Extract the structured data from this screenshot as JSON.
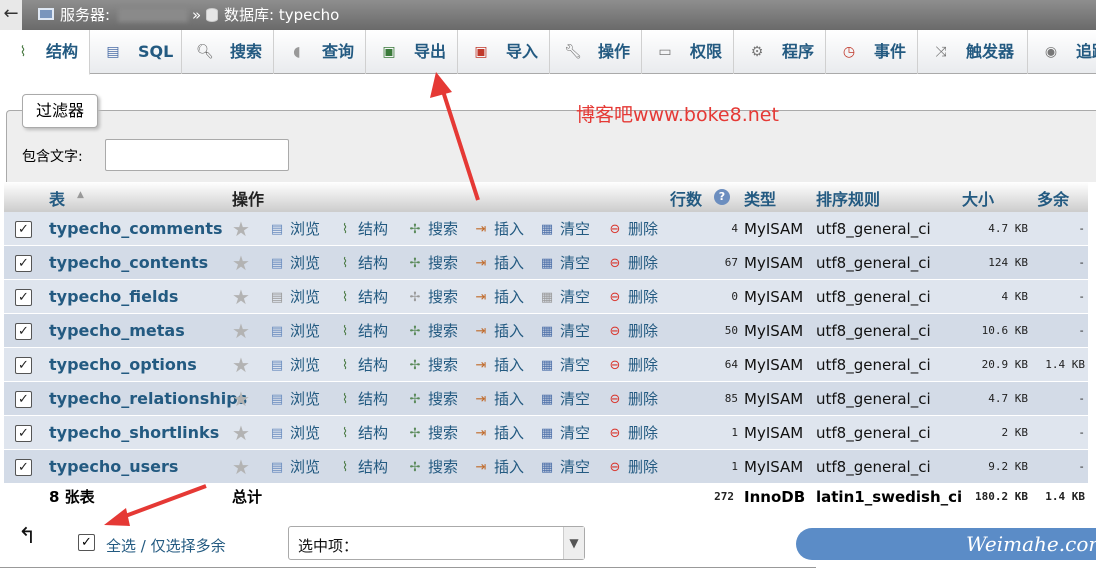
{
  "breadcrumb": {
    "back": "←",
    "server_label": "服务器:",
    "separator": "»",
    "database_label": "数据库: typecho"
  },
  "tabs": [
    {
      "label": "结构",
      "icon": "structure-icon",
      "active": true
    },
    {
      "label": "SQL",
      "icon": "sql-icon"
    },
    {
      "label": "搜索",
      "icon": "search-icon"
    },
    {
      "label": "查询",
      "icon": "query-icon"
    },
    {
      "label": "导出",
      "icon": "export-icon"
    },
    {
      "label": "导入",
      "icon": "import-icon"
    },
    {
      "label": "操作",
      "icon": "wrench-icon"
    },
    {
      "label": "权限",
      "icon": "privileges-icon"
    },
    {
      "label": "程序",
      "icon": "routines-icon"
    },
    {
      "label": "事件",
      "icon": "events-icon"
    },
    {
      "label": "触发器",
      "icon": "triggers-icon"
    },
    {
      "label": "追踪",
      "icon": "tracking-icon"
    }
  ],
  "watermark": "博客吧www.boke8.net",
  "filter": {
    "legend": "过滤器",
    "label": "包含文字:",
    "value": ""
  },
  "table": {
    "headers": {
      "table": "表",
      "action": "操作",
      "rows": "行数",
      "type": "类型",
      "collation": "排序规则",
      "size": "大小",
      "overhead": "多余"
    },
    "actions": {
      "browse": "浏览",
      "structure": "结构",
      "search": "搜索",
      "insert": "插入",
      "empty": "清空",
      "drop": "删除"
    },
    "rows": [
      {
        "name": "typecho_comments",
        "rows": "4",
        "type": "MyISAM",
        "collation": "utf8_general_ci",
        "size": "4.7 KB",
        "overhead": "-"
      },
      {
        "name": "typecho_contents",
        "rows": "67",
        "type": "MyISAM",
        "collation": "utf8_general_ci",
        "size": "124 KB",
        "overhead": "-"
      },
      {
        "name": "typecho_fields",
        "rows": "0",
        "type": "MyISAM",
        "collation": "utf8_general_ci",
        "size": "4 KB",
        "overhead": "-"
      },
      {
        "name": "typecho_metas",
        "rows": "50",
        "type": "MyISAM",
        "collation": "utf8_general_ci",
        "size": "10.6 KB",
        "overhead": "-"
      },
      {
        "name": "typecho_options",
        "rows": "64",
        "type": "MyISAM",
        "collation": "utf8_general_ci",
        "size": "20.9 KB",
        "overhead": "1.4 KB"
      },
      {
        "name": "typecho_relationships",
        "rows": "85",
        "type": "MyISAM",
        "collation": "utf8_general_ci",
        "size": "4.7 KB",
        "overhead": "-"
      },
      {
        "name": "typecho_shortlinks",
        "rows": "1",
        "type": "MyISAM",
        "collation": "utf8_general_ci",
        "size": "2 KB",
        "overhead": "-"
      },
      {
        "name": "typecho_users",
        "rows": "1",
        "type": "MyISAM",
        "collation": "utf8_general_ci",
        "size": "9.2 KB",
        "overhead": "-"
      }
    ],
    "footer": {
      "count": "8 张表",
      "total_label": "总计",
      "rows": "272",
      "type": "InnoDB",
      "collation": "latin1_swedish_ci",
      "size": "180.2 KB",
      "overhead": "1.4 KB"
    }
  },
  "bottom": {
    "check_all_label": "全选 / 仅选择多余",
    "select_label": "选中项：",
    "brand": "Weimahe.com"
  }
}
